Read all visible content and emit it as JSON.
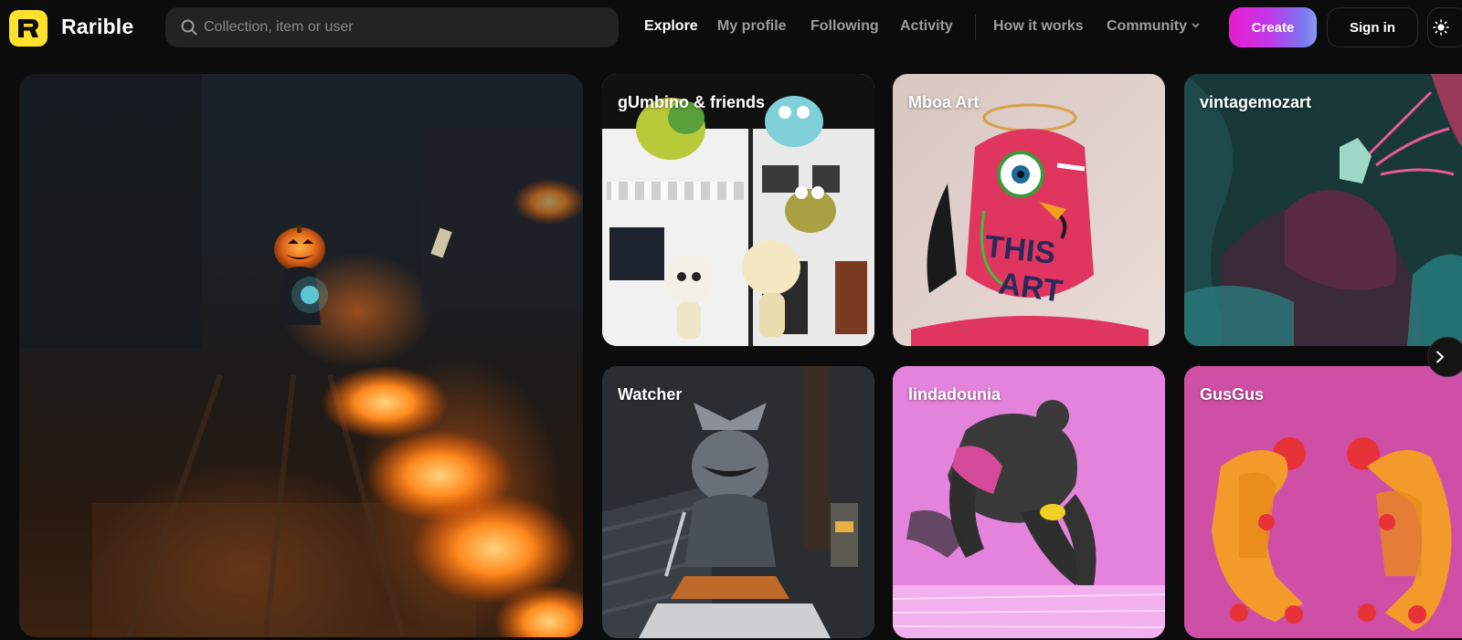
{
  "header": {
    "brand": "Rarible",
    "search_placeholder": "Collection, item or user",
    "nav": [
      {
        "label": "Explore",
        "active": true
      },
      {
        "label": "My profile",
        "active": false
      },
      {
        "label": "Following",
        "active": false
      },
      {
        "label": "Activity",
        "active": false
      },
      {
        "label": "How it works",
        "active": false
      },
      {
        "label": "Community",
        "active": false
      }
    ],
    "create_label": "Create",
    "signin_label": "Sign in"
  },
  "hero": {
    "icon": "pumpkin-rider-artwork"
  },
  "collections": [
    {
      "title": "gUmbino & friends"
    },
    {
      "title": "Mboa Art"
    },
    {
      "title": "vintagemozart"
    },
    {
      "title": "Watcher"
    },
    {
      "title": "lindadounia"
    },
    {
      "title": "GusGus"
    }
  ],
  "colors": {
    "brand_yellow": "#fee12b",
    "create_gradient_start": "#e81bcf",
    "create_gradient_end": "#8a9cf0",
    "background": "#0c0c0c"
  }
}
